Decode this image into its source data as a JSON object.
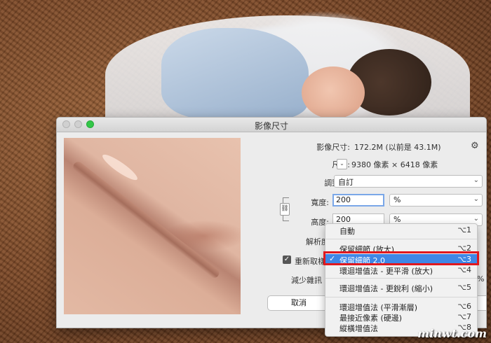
{
  "dialog": {
    "title": "影像尺寸",
    "image_size_label": "影像尺寸:",
    "image_size_value": "172.2M (以前是 43.1M)",
    "dimensions_label": "尺寸:",
    "dimensions_value": "9380 像素  ×  6418 像素",
    "fit_to_label": "調整至:",
    "fit_to_value": "自訂",
    "width_label": "寬度:",
    "width_value": "200",
    "width_unit": "%",
    "height_label": "高度:",
    "height_value": "200",
    "height_unit": "%",
    "resolution_label": "解析度",
    "resample_label": "重新取樣",
    "resample_checked": true,
    "reduce_noise_label": "減少雜訊",
    "reduce_noise_value": "%",
    "cancel_label": "取消"
  },
  "menu": {
    "items": [
      {
        "label": "自動",
        "shortcut": "⌥1"
      },
      {
        "label": "保留細節 (放大)",
        "shortcut": "⌥2"
      },
      {
        "label": "保留細節 2.0",
        "shortcut": "⌥3",
        "check": "✓"
      },
      {
        "label": "環迴增值法 - 更平滑 (放大)",
        "shortcut": "⌥4"
      },
      {
        "label": "環迴增值法 - 更銳利 (縮小)",
        "shortcut": "⌥5"
      },
      {
        "label": "環迴增值法 (平滑漸層)",
        "shortcut": "⌥6"
      },
      {
        "label": "最接近像素 (硬邊)",
        "shortcut": "⌥7"
      },
      {
        "label": "縱橫增值法",
        "shortcut": "⌥8"
      }
    ]
  },
  "icons": {
    "gear": "⚙",
    "chevron": "⌄",
    "stepper": "⌄",
    "link": "⛓",
    "checkbox": "✓"
  },
  "colors": {
    "selection": "#3f87e6",
    "highlight_box": "#e0181e",
    "traffic_green": "#33c748"
  }
}
